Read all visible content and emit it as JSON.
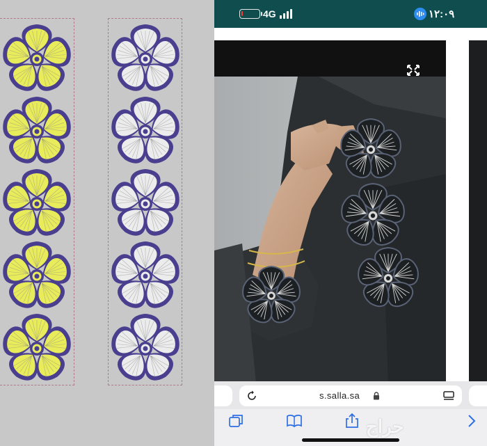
{
  "design_panel": {
    "yellow_flower_count": 5,
    "white_flower_count": 5,
    "colors": {
      "background": "#c8c8c8",
      "outline": "#4a3f8f",
      "yellow_fill": "#e9ec5a",
      "white_fill": "#ececec",
      "frame_dash": "#b07a8a"
    }
  },
  "status_bar": {
    "network": "4G",
    "time": "١٢:٠٩",
    "battery_level_percent": 10,
    "background_color": "#0f4d4f"
  },
  "browser": {
    "url": "s.salla.sa",
    "icons": {
      "reload": "reload-icon",
      "lock": "lock-icon",
      "reader": "reader-mode-icon",
      "expand": "expand-arrows-icon"
    }
  },
  "photo": {
    "subject": "embroidered black abaya sleeve with white flower embroidery"
  },
  "toolbar": {
    "icons": [
      "tabs-icon",
      "bookmarks-icon",
      "share-icon",
      "forward-icon"
    ]
  },
  "watermark": {
    "text": "حراج"
  }
}
